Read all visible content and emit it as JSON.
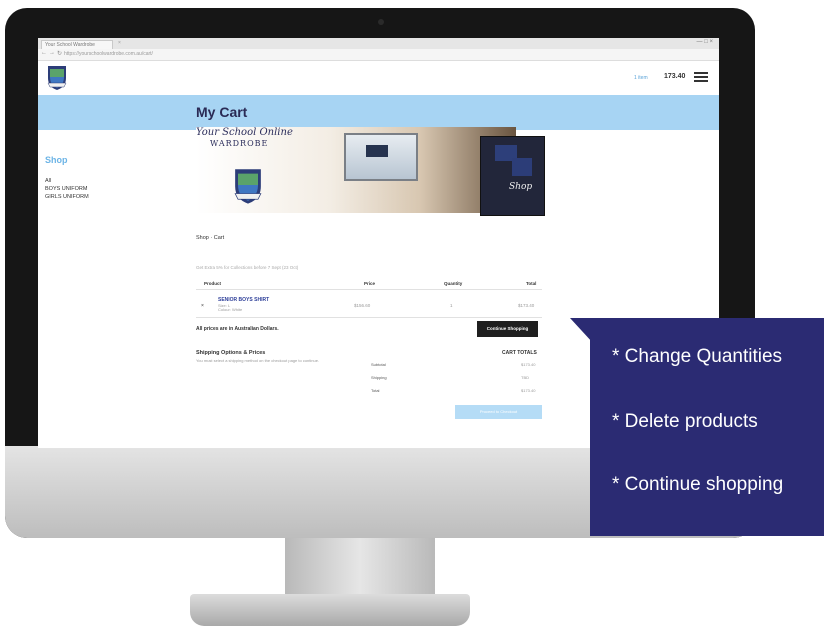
{
  "browser": {
    "tab_title": "Your School Wardrobe",
    "tab_close": "×",
    "window_controls": "— □ ×",
    "back": "←",
    "forward": "→",
    "reload": "↻",
    "url": "https://yourschoolwardrobe.com.au/cart/"
  },
  "header": {
    "cart_items": "1 item",
    "cart_total": "173.40",
    "menu_icon": "hamburger-icon"
  },
  "page": {
    "title": "My Cart"
  },
  "sidebar": {
    "heading": "Shop",
    "items": [
      "All",
      "BOYS UNIFORM",
      "GIRLS UNIFORM"
    ]
  },
  "banner": {
    "script_line": "Your School Online",
    "word": "WARDROBE",
    "card_script": "Shop"
  },
  "breadcrumb": "Shop · Cart",
  "notice": "Get Extra 5% for Collections before 7 Sept (23 Oct)",
  "table": {
    "headers": {
      "product": "Product",
      "price": "Price",
      "quantity": "Quantity",
      "total": "Total"
    },
    "rows": [
      {
        "remove": "×",
        "name": "SENIOR BOYS SHIRT",
        "sub1": "Size: L",
        "sub2": "Colour: White",
        "price": "$156.60",
        "quantity": "1",
        "total": "$173.40"
      }
    ]
  },
  "aud_note": "All prices are in Australian Dollars.",
  "continue_label": "Continue Shopping",
  "shipping": {
    "title": "Shipping Options & Prices",
    "desc": "You must select a shipping method on the checkout page to continue."
  },
  "totals": {
    "title": "CART TOTALS",
    "rows": [
      {
        "label": "Subtotal",
        "value": "$173.40"
      },
      {
        "label": "Shipping",
        "value": "TBD"
      },
      {
        "label": "Total",
        "value": "$173.40"
      }
    ]
  },
  "checkout_label": "Proceed to Checkout",
  "callout": {
    "items": [
      "* Change Quantities",
      "* Delete products",
      "* Continue shopping"
    ]
  },
  "colors": {
    "band": "#a7d4f3",
    "title": "#2a2a55",
    "callout": "#2b2b73",
    "accent": "#6cb4e6"
  }
}
